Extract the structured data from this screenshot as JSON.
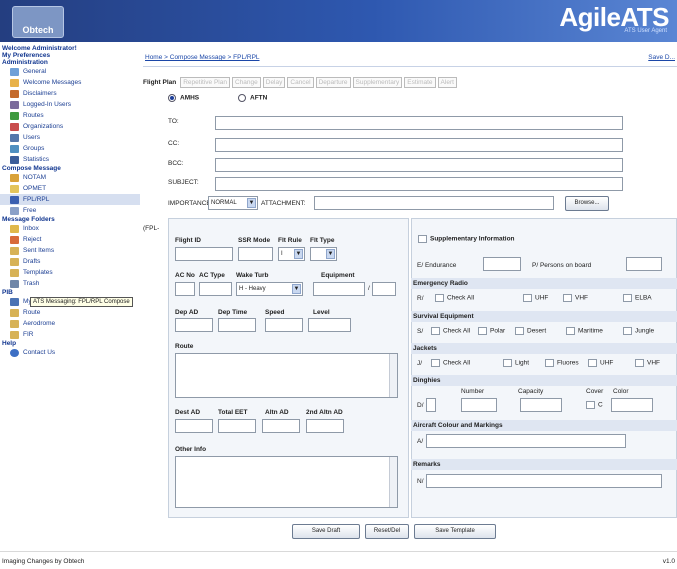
{
  "header": {
    "logo_text": "Obtech",
    "brand": "AgileATS",
    "brand_sub": "ATS User Agent"
  },
  "sidebar": {
    "welcome": "Welcome Administrator!",
    "my_preferences": "My Preferences",
    "administration": "Administration",
    "admin_items": [
      "General",
      "Welcome Messages",
      "Disclaimers",
      "Logged-In Users",
      "Routes",
      "Organizations",
      "Users",
      "Groups",
      "Statistics"
    ],
    "compose": "Compose Message",
    "compose_items": [
      "NOTAM",
      "OPMET",
      "FPL/RPL",
      "Free"
    ],
    "tooltip": "ATS Messaging: FPL/RPL Compose",
    "message_folders": "Message Folders",
    "folder_items": [
      "Inbox",
      "Reject",
      "Sent Items",
      "Drafts",
      "Templates",
      "Trash"
    ],
    "pib": "PIB",
    "pib_items": [
      "My Queries",
      "Route",
      "Aerodrome",
      "FIR"
    ],
    "help": "Help",
    "help_items": [
      "Contact Us"
    ]
  },
  "main": {
    "breadcrumb": "Home > Compose Message > FPL/RPL",
    "save_link": "Save D...",
    "tabs_label": "Flight Plan",
    "tabs": [
      "Repetitive Plan",
      "Change",
      "Delay",
      "Cancel",
      "Departure",
      "Supplementary",
      "Estimate",
      "Alert"
    ],
    "radio_amhs": "AMHS",
    "radio_aftn": "AFTN",
    "to_label": "TO:",
    "cc_label": "CC:",
    "bcc_label": "BCC:",
    "subject_label": "SUBJECT:",
    "importance_label": "IMPORTANCE:",
    "importance_value": "NORMAL",
    "attachment_label": "ATTACHMENT:",
    "browse": "Browse...",
    "fpl_label": "(FPL-",
    "flight_id": "Flight ID",
    "ssr_mode": "SSR Mode",
    "flt_rule": "Flt Rule",
    "flt_type": "Flt Type",
    "flt_rule_value": "I",
    "ac_no": "AC No",
    "ac_type": "AC Type",
    "wake_turb": "Wake Turb",
    "equipment": "Equipment",
    "wake_value": "H - Heavy",
    "slash": "/",
    "dep_ad": "Dep AD",
    "dep_time": "Dep Time",
    "speed": "Speed",
    "level": "Level",
    "route": "Route",
    "dest_ad": "Dest AD",
    "total_eet": "Total EET",
    "altn_ad": "Altn AD",
    "altn2": "2nd Altn AD",
    "other_info": "Other Info",
    "buttons": [
      "Save Draft",
      "Reset/Del",
      "Save Template"
    ]
  },
  "supp": {
    "title": "Supplementary Information",
    "endurance": "E/ Endurance",
    "persons": "P/ Persons on board",
    "emergency": "Emergency Radio",
    "r_prefix": "R/",
    "check_all": "Check All",
    "uhf": "UHF",
    "vhf": "VHF",
    "elba": "ELBA",
    "survival": "Survival Equipment",
    "s_prefix": "S/",
    "polar": "Polar",
    "desert": "Desert",
    "maritime": "Maritime",
    "jungle": "Jungle",
    "jackets": "Jackets",
    "j_prefix": "J/",
    "light": "Light",
    "fluores": "Fluores",
    "dinghies": "Dinghies",
    "number": "Number",
    "capacity": "Capacity",
    "cover": "Cover",
    "color": "Color",
    "d_prefix": "D/",
    "c_letter": "C",
    "aircraft": "Aircraft Colour and Markings",
    "a_prefix": "A/",
    "remarks": "Remarks",
    "n_prefix": "N/"
  },
  "footer": {
    "left": "Imaging Changes by Obtech",
    "right": "v1.0"
  },
  "colors": {
    "header": "#2e58b0",
    "link": "#1b47a8",
    "section": "#dfe6f2"
  }
}
